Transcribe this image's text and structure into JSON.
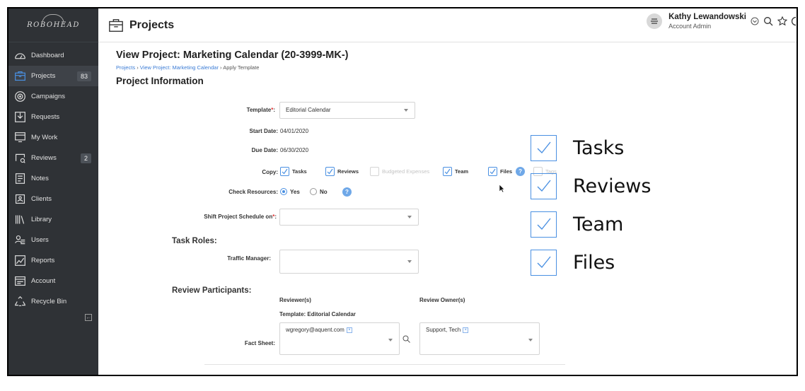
{
  "brand": {
    "logo_text": "ROBOHEAD"
  },
  "sidebar": {
    "items": [
      {
        "label": "Dashboard",
        "icon": "dashboard-icon"
      },
      {
        "label": "Projects",
        "icon": "briefcase-icon",
        "badge": "83"
      },
      {
        "label": "Campaigns",
        "icon": "target-icon"
      },
      {
        "label": "Requests",
        "icon": "inbox-icon"
      },
      {
        "label": "My Work",
        "icon": "monitor-icon"
      },
      {
        "label": "Reviews",
        "icon": "review-icon",
        "badge": "2"
      },
      {
        "label": "Notes",
        "icon": "notes-icon"
      },
      {
        "label": "Clients",
        "icon": "clients-icon"
      },
      {
        "label": "Library",
        "icon": "library-icon"
      },
      {
        "label": "Users",
        "icon": "users-icon"
      },
      {
        "label": "Reports",
        "icon": "reports-icon"
      },
      {
        "label": "Account",
        "icon": "account-icon"
      },
      {
        "label": "Recycle Bin",
        "icon": "recycle-icon"
      }
    ],
    "collapse_glyph": "←"
  },
  "header": {
    "title": "Projects",
    "user_name": "Kathy Lewandowski",
    "user_role": "Account Admin"
  },
  "main": {
    "page_title": "View Project: Marketing Calendar (20-3999-MK-)",
    "breadcrumb": {
      "projects": "Projects",
      "view": "View Project: Marketing Calendar",
      "current": "Apply Template",
      "sep": "›"
    },
    "section": "Project Information",
    "template": {
      "label": "Template",
      "req": "*",
      "colon": ":",
      "value": "Editorial Calendar"
    },
    "start_date": {
      "label": "Start Date:",
      "value": "04/01/2020"
    },
    "due_date": {
      "label": "Due Date:",
      "value": "06/30/2020"
    },
    "copy": {
      "label": "Copy:",
      "options": [
        {
          "label": "Tasks",
          "checked": true
        },
        {
          "label": "Reviews",
          "checked": true
        },
        {
          "label": "Budgeted Expenses",
          "checked": false
        },
        {
          "label": "Team",
          "checked": true
        },
        {
          "label": "Files",
          "checked": true
        },
        {
          "label": "Tags",
          "checked": false
        }
      ],
      "help": "?"
    },
    "check_resources": {
      "label": "Check Resources:",
      "yes": "Yes",
      "no": "No",
      "selected": "Yes",
      "help": "?"
    },
    "shift_schedule": {
      "label": "Shift Project Schedule on",
      "req": "*",
      "colon": ":",
      "value": ""
    },
    "task_roles": {
      "heading": "Task Roles:",
      "traffic_manager_label": "Traffic Manager:",
      "traffic_manager_value": ""
    },
    "review_participants": {
      "heading": "Review Participants:",
      "reviewers_header": "Reviewer(s)",
      "owners_header": "Review Owner(s)",
      "template_note": "Template: Editorial Calendar",
      "row_label": "Fact Sheet:",
      "reviewer": "wgregory@aquent.com",
      "owner": "Support, Tech",
      "remove": "×"
    }
  },
  "callout": {
    "items": [
      "Tasks",
      "Reviews",
      "Team",
      "Files"
    ]
  },
  "colors": {
    "accent": "#4a90e2",
    "sidebar": "#2f3236",
    "required": "#dd3333"
  }
}
